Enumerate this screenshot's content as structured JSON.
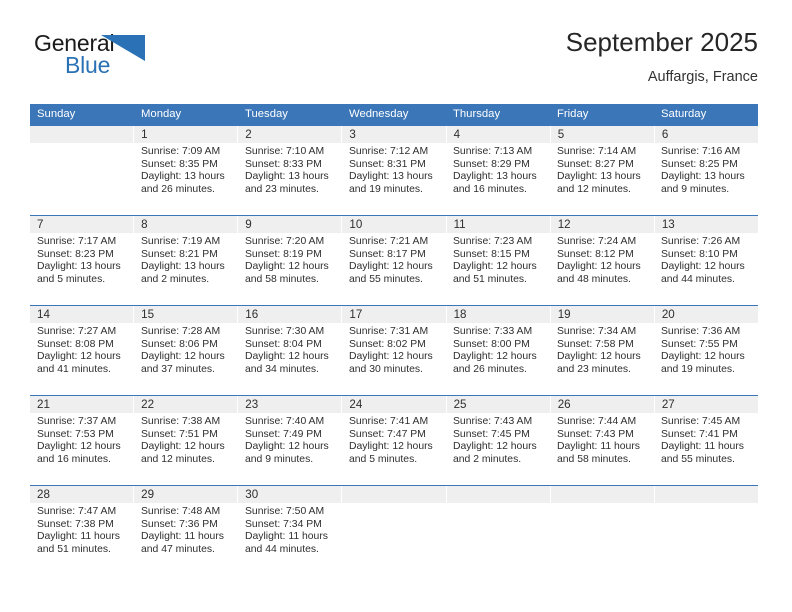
{
  "brand": {
    "name_top": "General",
    "name_bottom": "Blue",
    "triangle_color": "#2a72b5",
    "top_color": "#1b1b1b",
    "bottom_color": "#2a72b5"
  },
  "header": {
    "title": "September 2025",
    "subtitle": "Auffargis, France"
  },
  "theme": {
    "header_blue": "#3b76b8",
    "date_band_gray": "#efefef",
    "text_color": "#2f2f2f"
  },
  "weekday_headers": [
    "Sunday",
    "Monday",
    "Tuesday",
    "Wednesday",
    "Thursday",
    "Friday",
    "Saturday"
  ],
  "weeks": [
    {
      "days": [
        {
          "num": "",
          "sunrise": "",
          "sunset": "",
          "daylight_line1": "",
          "daylight_line2": "",
          "empty": true
        },
        {
          "num": "1",
          "sunrise": "Sunrise: 7:09 AM",
          "sunset": "Sunset: 8:35 PM",
          "daylight_line1": "Daylight: 13 hours",
          "daylight_line2": "and 26 minutes.",
          "empty": false
        },
        {
          "num": "2",
          "sunrise": "Sunrise: 7:10 AM",
          "sunset": "Sunset: 8:33 PM",
          "daylight_line1": "Daylight: 13 hours",
          "daylight_line2": "and 23 minutes.",
          "empty": false
        },
        {
          "num": "3",
          "sunrise": "Sunrise: 7:12 AM",
          "sunset": "Sunset: 8:31 PM",
          "daylight_line1": "Daylight: 13 hours",
          "daylight_line2": "and 19 minutes.",
          "empty": false
        },
        {
          "num": "4",
          "sunrise": "Sunrise: 7:13 AM",
          "sunset": "Sunset: 8:29 PM",
          "daylight_line1": "Daylight: 13 hours",
          "daylight_line2": "and 16 minutes.",
          "empty": false
        },
        {
          "num": "5",
          "sunrise": "Sunrise: 7:14 AM",
          "sunset": "Sunset: 8:27 PM",
          "daylight_line1": "Daylight: 13 hours",
          "daylight_line2": "and 12 minutes.",
          "empty": false
        },
        {
          "num": "6",
          "sunrise": "Sunrise: 7:16 AM",
          "sunset": "Sunset: 8:25 PM",
          "daylight_line1": "Daylight: 13 hours",
          "daylight_line2": "and 9 minutes.",
          "empty": false
        }
      ]
    },
    {
      "days": [
        {
          "num": "7",
          "sunrise": "Sunrise: 7:17 AM",
          "sunset": "Sunset: 8:23 PM",
          "daylight_line1": "Daylight: 13 hours",
          "daylight_line2": "and 5 minutes.",
          "empty": false
        },
        {
          "num": "8",
          "sunrise": "Sunrise: 7:19 AM",
          "sunset": "Sunset: 8:21 PM",
          "daylight_line1": "Daylight: 13 hours",
          "daylight_line2": "and 2 minutes.",
          "empty": false
        },
        {
          "num": "9",
          "sunrise": "Sunrise: 7:20 AM",
          "sunset": "Sunset: 8:19 PM",
          "daylight_line1": "Daylight: 12 hours",
          "daylight_line2": "and 58 minutes.",
          "empty": false
        },
        {
          "num": "10",
          "sunrise": "Sunrise: 7:21 AM",
          "sunset": "Sunset: 8:17 PM",
          "daylight_line1": "Daylight: 12 hours",
          "daylight_line2": "and 55 minutes.",
          "empty": false
        },
        {
          "num": "11",
          "sunrise": "Sunrise: 7:23 AM",
          "sunset": "Sunset: 8:15 PM",
          "daylight_line1": "Daylight: 12 hours",
          "daylight_line2": "and 51 minutes.",
          "empty": false
        },
        {
          "num": "12",
          "sunrise": "Sunrise: 7:24 AM",
          "sunset": "Sunset: 8:12 PM",
          "daylight_line1": "Daylight: 12 hours",
          "daylight_line2": "and 48 minutes.",
          "empty": false
        },
        {
          "num": "13",
          "sunrise": "Sunrise: 7:26 AM",
          "sunset": "Sunset: 8:10 PM",
          "daylight_line1": "Daylight: 12 hours",
          "daylight_line2": "and 44 minutes.",
          "empty": false
        }
      ]
    },
    {
      "days": [
        {
          "num": "14",
          "sunrise": "Sunrise: 7:27 AM",
          "sunset": "Sunset: 8:08 PM",
          "daylight_line1": "Daylight: 12 hours",
          "daylight_line2": "and 41 minutes.",
          "empty": false
        },
        {
          "num": "15",
          "sunrise": "Sunrise: 7:28 AM",
          "sunset": "Sunset: 8:06 PM",
          "daylight_line1": "Daylight: 12 hours",
          "daylight_line2": "and 37 minutes.",
          "empty": false
        },
        {
          "num": "16",
          "sunrise": "Sunrise: 7:30 AM",
          "sunset": "Sunset: 8:04 PM",
          "daylight_line1": "Daylight: 12 hours",
          "daylight_line2": "and 34 minutes.",
          "empty": false
        },
        {
          "num": "17",
          "sunrise": "Sunrise: 7:31 AM",
          "sunset": "Sunset: 8:02 PM",
          "daylight_line1": "Daylight: 12 hours",
          "daylight_line2": "and 30 minutes.",
          "empty": false
        },
        {
          "num": "18",
          "sunrise": "Sunrise: 7:33 AM",
          "sunset": "Sunset: 8:00 PM",
          "daylight_line1": "Daylight: 12 hours",
          "daylight_line2": "and 26 minutes.",
          "empty": false
        },
        {
          "num": "19",
          "sunrise": "Sunrise: 7:34 AM",
          "sunset": "Sunset: 7:58 PM",
          "daylight_line1": "Daylight: 12 hours",
          "daylight_line2": "and 23 minutes.",
          "empty": false
        },
        {
          "num": "20",
          "sunrise": "Sunrise: 7:36 AM",
          "sunset": "Sunset: 7:55 PM",
          "daylight_line1": "Daylight: 12 hours",
          "daylight_line2": "and 19 minutes.",
          "empty": false
        }
      ]
    },
    {
      "days": [
        {
          "num": "21",
          "sunrise": "Sunrise: 7:37 AM",
          "sunset": "Sunset: 7:53 PM",
          "daylight_line1": "Daylight: 12 hours",
          "daylight_line2": "and 16 minutes.",
          "empty": false
        },
        {
          "num": "22",
          "sunrise": "Sunrise: 7:38 AM",
          "sunset": "Sunset: 7:51 PM",
          "daylight_line1": "Daylight: 12 hours",
          "daylight_line2": "and 12 minutes.",
          "empty": false
        },
        {
          "num": "23",
          "sunrise": "Sunrise: 7:40 AM",
          "sunset": "Sunset: 7:49 PM",
          "daylight_line1": "Daylight: 12 hours",
          "daylight_line2": "and 9 minutes.",
          "empty": false
        },
        {
          "num": "24",
          "sunrise": "Sunrise: 7:41 AM",
          "sunset": "Sunset: 7:47 PM",
          "daylight_line1": "Daylight: 12 hours",
          "daylight_line2": "and 5 minutes.",
          "empty": false
        },
        {
          "num": "25",
          "sunrise": "Sunrise: 7:43 AM",
          "sunset": "Sunset: 7:45 PM",
          "daylight_line1": "Daylight: 12 hours",
          "daylight_line2": "and 2 minutes.",
          "empty": false
        },
        {
          "num": "26",
          "sunrise": "Sunrise: 7:44 AM",
          "sunset": "Sunset: 7:43 PM",
          "daylight_line1": "Daylight: 11 hours",
          "daylight_line2": "and 58 minutes.",
          "empty": false
        },
        {
          "num": "27",
          "sunrise": "Sunrise: 7:45 AM",
          "sunset": "Sunset: 7:41 PM",
          "daylight_line1": "Daylight: 11 hours",
          "daylight_line2": "and 55 minutes.",
          "empty": false
        }
      ]
    },
    {
      "days": [
        {
          "num": "28",
          "sunrise": "Sunrise: 7:47 AM",
          "sunset": "Sunset: 7:38 PM",
          "daylight_line1": "Daylight: 11 hours",
          "daylight_line2": "and 51 minutes.",
          "empty": false
        },
        {
          "num": "29",
          "sunrise": "Sunrise: 7:48 AM",
          "sunset": "Sunset: 7:36 PM",
          "daylight_line1": "Daylight: 11 hours",
          "daylight_line2": "and 47 minutes.",
          "empty": false
        },
        {
          "num": "30",
          "sunrise": "Sunrise: 7:50 AM",
          "sunset": "Sunset: 7:34 PM",
          "daylight_line1": "Daylight: 11 hours",
          "daylight_line2": "and 44 minutes.",
          "empty": false
        },
        {
          "num": "",
          "sunrise": "",
          "sunset": "",
          "daylight_line1": "",
          "daylight_line2": "",
          "empty": true
        },
        {
          "num": "",
          "sunrise": "",
          "sunset": "",
          "daylight_line1": "",
          "daylight_line2": "",
          "empty": true
        },
        {
          "num": "",
          "sunrise": "",
          "sunset": "",
          "daylight_line1": "",
          "daylight_line2": "",
          "empty": true
        },
        {
          "num": "",
          "sunrise": "",
          "sunset": "",
          "daylight_line1": "",
          "daylight_line2": "",
          "empty": true
        }
      ]
    }
  ]
}
